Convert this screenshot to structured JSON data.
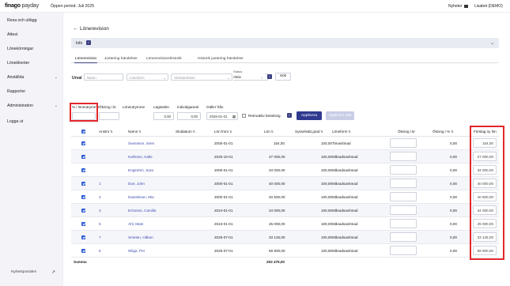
{
  "header": {
    "logo_main": "finago",
    "logo_sub": " payday",
    "period": "Öppen period: Juli 2025",
    "news": "Nyheter",
    "user": "Lisabet (DEMO)"
  },
  "sidebar": {
    "items": [
      {
        "label": "Resa och utlägg",
        "chevron": ""
      },
      {
        "label": "Attest",
        "chevron": ""
      },
      {
        "label": "Lönekörningar",
        "chevron": ""
      },
      {
        "label": "Löneklienter",
        "chevron": ""
      },
      {
        "label": "Anställda",
        "chevron": "⌄"
      },
      {
        "label": "Rapporter",
        "chevron": ""
      },
      {
        "label": "Administration",
        "chevron": "⌄"
      },
      {
        "label": "Logga ut",
        "chevron": ""
      }
    ],
    "bottom_link": "Nyhetsportalen"
  },
  "page": {
    "title": "Lönerevision",
    "info_label": "Info",
    "info_badge": "i"
  },
  "tabs": [
    {
      "label": "Lönerevision",
      "active": true
    },
    {
      "label": "Justering händelser",
      "active": false
    },
    {
      "label": "Lönerevisionshistorik",
      "active": false
    },
    {
      "label": "Historik justering händelser",
      "active": false
    }
  ],
  "filters": {
    "urval_label": "Urval",
    "name_placeholder": "Namn",
    "loneform_placeholder": "Löneform",
    "verksamhet_placeholder": "Verksamheter",
    "empty_select": "",
    "status_label": "Status",
    "status_value": "Aktiv",
    "search_label": "Sök"
  },
  "bulk": {
    "pct_label": "% i löneutrymme",
    "okning_label": "Ökning i kr",
    "loneutrymme_label": "Löneutrymme",
    "lagstalon_label": "Lägstalön",
    "individgaranti_label": "Individgaranti",
    "galler_fran_label": "Gäller från",
    "pct_value": "",
    "okning_value": "",
    "loneutrymme_value": "",
    "lagstalon_value": "0,00",
    "individgaranti_value": "0,00",
    "galler_fran_value": "2026-01-01",
    "retroaktiv_label": "Retroaktiv betalning",
    "apply_label": "Applicera",
    "apply_all_label": "Applicera alla"
  },
  "table": {
    "headers": {
      "anstnr": "Anstnr",
      "namn": "Namn",
      "slutdatum": "Slutdatum",
      "lon_from": "Lön from",
      "lon": "Lön",
      "syssgrad": "Sysselsätt.grad",
      "loneform": "Löneform",
      "okning_kr": "Ökning i kr",
      "okning_pct": "Ökning i %",
      "forslag": "Förslag ny lön"
    },
    "rows": [
      {
        "anstnr": "",
        "namn": "Svensson, Sven",
        "slutdatum": "",
        "lon_from": "2000-01-01",
        "lon": "154,00",
        "syssgrad": "100,00",
        "loneform": "Timavlönad",
        "okning_kr": "",
        "okning_pct": "0,00",
        "forslag": "154,00"
      },
      {
        "anstnr": "",
        "namn": "Karlsson, Kalle",
        "slutdatum": "",
        "lon_from": "2025-10-01",
        "lon": "27 000,00",
        "syssgrad": "100,00",
        "loneform": "Månadsavlönad",
        "okning_kr": "",
        "okning_pct": "0,00",
        "forslag": "27 000,00"
      },
      {
        "anstnr": "",
        "namn": "Engström, Sara",
        "slutdatum": "",
        "lon_from": "2000-01-01",
        "lon": "34 000,00",
        "syssgrad": "100,00",
        "loneform": "Månadsavlönad",
        "okning_kr": "",
        "okning_pct": "0,00",
        "forslag": "34 000,00"
      },
      {
        "anstnr": "1",
        "namn": "Doe, John",
        "slutdatum": "",
        "lon_from": "2000-01-01",
        "lon": "40 000,00",
        "syssgrad": "100,00",
        "loneform": "Månadsavlönad",
        "okning_kr": "",
        "okning_pct": "0,00",
        "forslag": "40 000,00"
      },
      {
        "anstnr": "2",
        "namn": "Danielsson, Mia",
        "slutdatum": "",
        "lon_from": "2000-01-01",
        "lon": "40 500,00",
        "syssgrad": "100,00",
        "loneform": "Månadsavlönad",
        "okning_kr": "",
        "okning_pct": "0,00",
        "forslag": "40 500,00"
      },
      {
        "anstnr": "3",
        "namn": "Ericsson, Camilla",
        "slutdatum": "",
        "lon_from": "2024-01-01",
        "lon": "34 000,00",
        "syssgrad": "100,00",
        "loneform": "Månadsavlönad",
        "okning_kr": "",
        "okning_pct": "0,00",
        "forslag": "34 000,00"
      },
      {
        "anstnr": "6",
        "namn": "Ahl, Mats",
        "slutdatum": "",
        "lon_from": "2023-01-01",
        "lon": "25 000,00",
        "syssgrad": "100,00",
        "loneform": "Månadsavlönad",
        "okning_kr": "",
        "okning_pct": "0,00",
        "forslag": "25 000,00"
      },
      {
        "anstnr": "7",
        "namn": "Smeten, Håkan",
        "slutdatum": "",
        "lon_from": "2025-07-01",
        "lon": "33 125,00",
        "syssgrad": "100,00",
        "loneform": "Månadsavlönad",
        "okning_kr": "",
        "okning_pct": "0,00",
        "forslag": "33 125,00"
      },
      {
        "anstnr": "8",
        "namn": "Wiiga, Per",
        "slutdatum": "",
        "lon_from": "2025-07-01",
        "lon": "59 900,00",
        "syssgrad": "100,00",
        "loneform": "Månadsavlönad",
        "okning_kr": "",
        "okning_pct": "0,00",
        "forslag": "59 900,00"
      }
    ],
    "sum_label": "Summa",
    "sum_value": "293 479,00"
  },
  "colors": {
    "accent": "#2f3a8f",
    "link": "#3f4bb0",
    "checkbox": "#2f5bd6",
    "highlight_box": "#e3262b",
    "sidebar_bg": "#f4f4f8"
  }
}
